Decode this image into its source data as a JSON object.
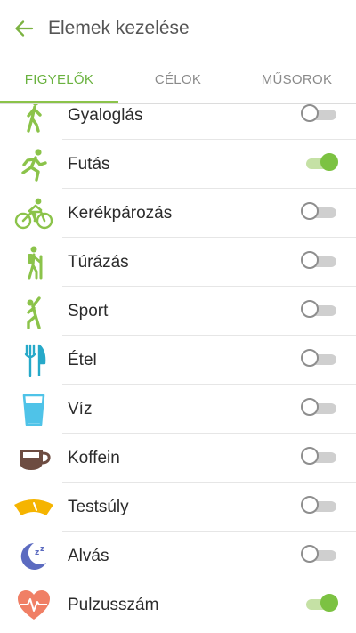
{
  "header": {
    "title": "Elemek kezelése",
    "back_icon": "arrow-left-icon"
  },
  "tabs": [
    {
      "label": "FIGYELŐK",
      "active": true
    },
    {
      "label": "CÉLOK",
      "active": false
    },
    {
      "label": "MŰSOROK",
      "active": false
    }
  ],
  "colors": {
    "accent": "#8bc34a",
    "toggle_on": "#7cc242"
  },
  "items": [
    {
      "label": "Gyaloglás",
      "icon": "walking-icon",
      "enabled": false
    },
    {
      "label": "Futás",
      "icon": "running-icon",
      "enabled": true
    },
    {
      "label": "Kerékpározás",
      "icon": "cycling-icon",
      "enabled": false
    },
    {
      "label": "Túrázás",
      "icon": "hiking-icon",
      "enabled": false
    },
    {
      "label": "Sport",
      "icon": "sport-icon",
      "enabled": false
    },
    {
      "label": "Étel",
      "icon": "fork-knife-icon",
      "enabled": false
    },
    {
      "label": "Víz",
      "icon": "water-glass-icon",
      "enabled": false
    },
    {
      "label": "Koffein",
      "icon": "coffee-cup-icon",
      "enabled": false
    },
    {
      "label": "Testsúly",
      "icon": "scale-icon",
      "enabled": false
    },
    {
      "label": "Alvás",
      "icon": "moon-icon",
      "enabled": false
    },
    {
      "label": "Pulzusszám",
      "icon": "heart-rate-icon",
      "enabled": true
    }
  ]
}
